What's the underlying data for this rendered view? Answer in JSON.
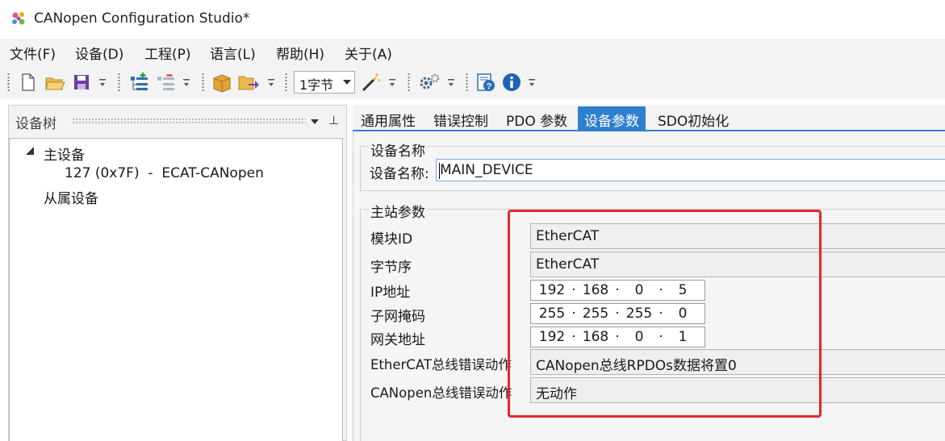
{
  "window": {
    "title": "CANopen Configuration Studio*"
  },
  "menu": [
    "文件(F)",
    "设备(D)",
    "工程(P)",
    "语言(L)",
    "帮助(H)",
    "关于(A)"
  ],
  "toolbar": {
    "bytes_select_value": "1字节",
    "icons": [
      "new-file-icon",
      "open-folder-icon",
      "save-icon",
      "add-device-icon",
      "remove-device-icon",
      "package-icon",
      "export-icon",
      "wand-icon",
      "settings-gear-icon",
      "help-icon",
      "info-icon"
    ]
  },
  "device_tree": {
    "title": "设备树",
    "pin_glyph": "⊥",
    "nodes": {
      "master": "主设备",
      "master_child": "127 (0x7F)  -  ECAT-CANopen",
      "slave": "从属设备"
    }
  },
  "tabs": [
    "通用属性",
    "错误控制",
    "PDO 参数",
    "设备参数",
    "SDO初始化"
  ],
  "active_tab": "设备参数",
  "device_name_group": {
    "title": "设备名称",
    "label": "设备名称:",
    "value": "MAIN_DEVICE"
  },
  "master_params_group": {
    "title": "主站参数",
    "fields": {
      "module_id": {
        "label": "模块ID",
        "value": "EtherCAT"
      },
      "byte_order": {
        "label": "字节序",
        "value": "EtherCAT"
      },
      "ip": {
        "label": "IP地址",
        "octets": [
          "192",
          "168",
          "0",
          "5"
        ]
      },
      "subnet": {
        "label": "子网掩码",
        "octets": [
          "255",
          "255",
          "255",
          "0"
        ]
      },
      "gateway": {
        "label": "网关地址",
        "octets": [
          "192",
          "168",
          "0",
          "1"
        ]
      },
      "ethercat_error_action": {
        "label": "EtherCAT总线错误动作",
        "value": "CANopen总线RPDOs数据将置0"
      },
      "canopen_error_action": {
        "label": "CANopen总线错误动作",
        "value": "无动作"
      }
    }
  },
  "ip_separator": "·",
  "colors": {
    "accent": "#2f7fd0",
    "highlight": "#e8262a"
  }
}
